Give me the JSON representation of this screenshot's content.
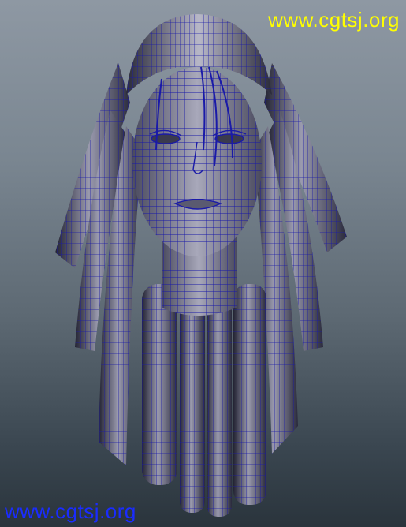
{
  "watermark": {
    "top": "www.cgtsj.org",
    "bottom": "www.cgtsj.org"
  },
  "colors": {
    "wireframe": "#1a1aa8",
    "top_watermark": "#ffff00",
    "bottom_watermark": "#1a2cff"
  },
  "viewport_content": "3d-head-wireframe-model"
}
